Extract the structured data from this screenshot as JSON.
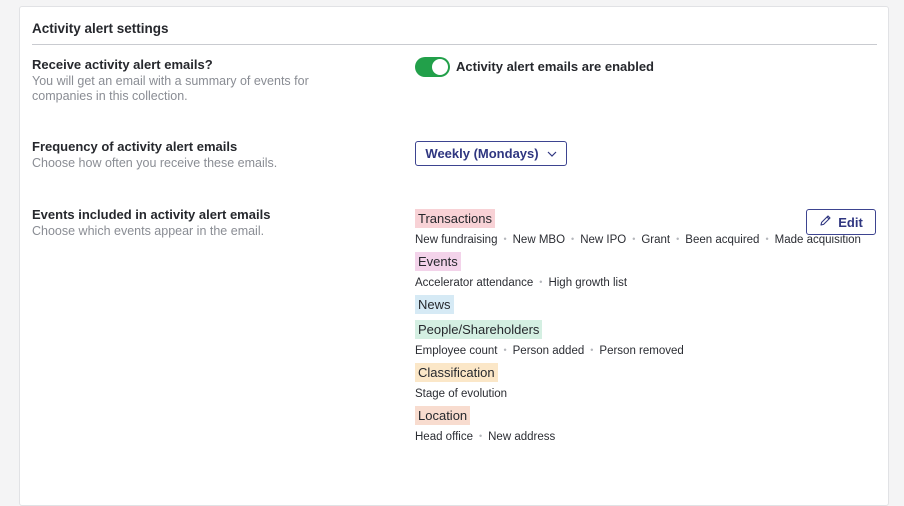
{
  "settings": {
    "title": "Activity alert settings",
    "receive": {
      "label": "Receive activity alert emails?",
      "description": "You will get an email with a summary of events for companies in this collection.",
      "toggle_on": true,
      "status": "Activity alert emails are enabled"
    },
    "frequency": {
      "label": "Frequency of activity alert emails",
      "description": "Choose how often you receive these emails.",
      "selected": "Weekly (Mondays)"
    },
    "events": {
      "label": "Events included in activity alert emails",
      "description": "Choose which events appear in the email.",
      "edit_label": "Edit",
      "categories": [
        {
          "name": "Transactions",
          "color": "#f8d2d6",
          "items": [
            "New fundraising",
            "New MBO",
            "New IPO",
            "Grant",
            "Been acquired",
            "Made acquisition"
          ]
        },
        {
          "name": "Events",
          "color": "#f3d3ea",
          "items": [
            "Accelerator attendance",
            "High growth list"
          ]
        },
        {
          "name": "News",
          "color": "#d6eaf5",
          "items": []
        },
        {
          "name": "People/Shareholders",
          "color": "#d4efe2",
          "items": [
            "Employee count",
            "Person added",
            "Person removed"
          ]
        },
        {
          "name": "Classification",
          "color": "#fbe7c8",
          "items": [
            "Stage of evolution"
          ]
        },
        {
          "name": "Location",
          "color": "#f8dccf",
          "items": [
            "Head office",
            "New address"
          ]
        }
      ]
    }
  },
  "colors": {
    "toggle_on": "#22a04a",
    "button_border": "#3d4490",
    "button_text": "#2f3680"
  },
  "icons": {
    "dropdown": "chevron-down-icon",
    "edit": "pencil-icon"
  }
}
